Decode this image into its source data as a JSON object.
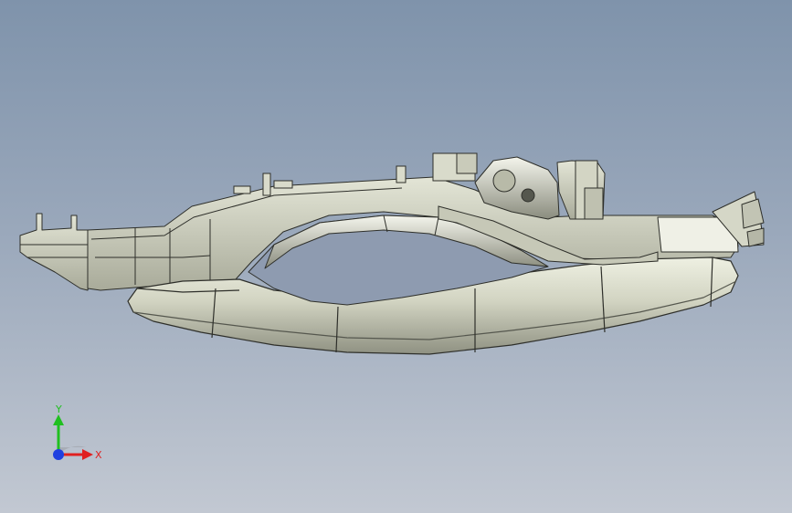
{
  "viewport": {
    "background_top": "#7f93ab",
    "background_bottom": "#c2c8d2"
  },
  "model": {
    "body_color": "#d7d8c8",
    "shadow_color": "#8d8e80",
    "edge_color": "#2e2f2a"
  },
  "triad": {
    "x_label": "X",
    "y_label": "Y",
    "x_color": "#e02020",
    "y_color": "#20c020",
    "z_color": "#2040e0"
  }
}
